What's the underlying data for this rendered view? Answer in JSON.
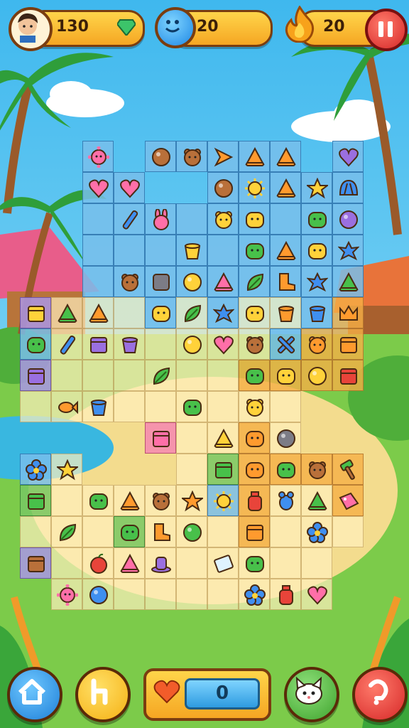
{
  "hud": {
    "score": "130",
    "gems": "20",
    "streak": "20"
  },
  "lives": {
    "value": "0"
  },
  "colors": {
    "accent": "#f5a623",
    "frame": "#7a3d10",
    "pause": "#d62828",
    "sky": "#6fd0f5",
    "grass": "#7ccb4a"
  },
  "board": {
    "rows": 15,
    "cols": 11
  },
  "tiles": [
    {
      "r": 0,
      "c": 2,
      "kind": "pink-virus",
      "t": "b"
    },
    {
      "r": 0,
      "c": 4,
      "kind": "brown-nut",
      "t": "b"
    },
    {
      "r": 0,
      "c": 5,
      "kind": "brown-bear",
      "t": "b"
    },
    {
      "r": 0,
      "c": 6,
      "kind": "orange-arrow",
      "t": "b"
    },
    {
      "r": 0,
      "c": 7,
      "kind": "orange-cone",
      "t": "b"
    },
    {
      "r": 0,
      "c": 8,
      "kind": "orange-cone",
      "t": "b"
    },
    {
      "r": 0,
      "c": 10,
      "kind": "purple-heart",
      "t": "b"
    },
    {
      "r": 1,
      "c": 2,
      "kind": "pink-heart",
      "t": "b"
    },
    {
      "r": 1,
      "c": 3,
      "kind": "pink-heart",
      "t": "b"
    },
    {
      "r": 1,
      "c": 6,
      "kind": "brown-nut",
      "t": "b"
    },
    {
      "r": 1,
      "c": 7,
      "kind": "yellow-sun",
      "t": "b"
    },
    {
      "r": 1,
      "c": 8,
      "kind": "orange-cone",
      "t": "b"
    },
    {
      "r": 1,
      "c": 9,
      "kind": "yellow-star",
      "t": "b"
    },
    {
      "r": 1,
      "c": 10,
      "kind": "blue-shell",
      "t": "b"
    },
    {
      "r": 2,
      "c": 3,
      "kind": "blue-stick",
      "t": "b"
    },
    {
      "r": 2,
      "c": 4,
      "kind": "pink-bunny",
      "t": "b"
    },
    {
      "r": 2,
      "c": 6,
      "kind": "yellow-bear",
      "t": "b"
    },
    {
      "r": 2,
      "c": 7,
      "kind": "yellow-blob",
      "t": "b"
    },
    {
      "r": 2,
      "c": 9,
      "kind": "green-blob",
      "t": "b"
    },
    {
      "r": 2,
      "c": 10,
      "kind": "purple-berry",
      "t": "b"
    },
    {
      "r": 3,
      "c": 5,
      "kind": "yellow-cup",
      "t": "b"
    },
    {
      "r": 3,
      "c": 7,
      "kind": "green-blob",
      "t": "b"
    },
    {
      "r": 3,
      "c": 8,
      "kind": "orange-cone",
      "t": "b"
    },
    {
      "r": 3,
      "c": 9,
      "kind": "yellow-blob",
      "t": "b"
    },
    {
      "r": 3,
      "c": 10,
      "kind": "blue-splat",
      "t": "b"
    },
    {
      "r": 4,
      "c": 3,
      "kind": "brown-bear",
      "t": "b"
    },
    {
      "r": 4,
      "c": 4,
      "kind": "gray-block",
      "t": "b"
    },
    {
      "r": 4,
      "c": 5,
      "kind": "yellow-ball",
      "t": "b"
    },
    {
      "r": 4,
      "c": 6,
      "kind": "pink-cone",
      "t": "b"
    },
    {
      "r": 4,
      "c": 7,
      "kind": "green-leaf",
      "t": "b"
    },
    {
      "r": 4,
      "c": 8,
      "kind": "orange-boot",
      "t": "b"
    },
    {
      "r": 4,
      "c": 9,
      "kind": "blue-splat",
      "t": "b"
    },
    {
      "r": 4,
      "c": 10,
      "kind": "green-cone",
      "t": "b"
    },
    {
      "r": 5,
      "c": 0,
      "kind": "yellow-box",
      "t": "p"
    },
    {
      "r": 5,
      "c": 1,
      "kind": "green-cone",
      "t": "w"
    },
    {
      "r": 5,
      "c": 2,
      "kind": "orange-cone",
      "t": "w"
    },
    {
      "r": 5,
      "c": 4,
      "kind": "yellow-blob",
      "t": "b"
    },
    {
      "r": 5,
      "c": 5,
      "kind": "green-leaf",
      "t": "w"
    },
    {
      "r": 5,
      "c": 6,
      "kind": "blue-splat",
      "t": "b"
    },
    {
      "r": 5,
      "c": 7,
      "kind": "yellow-blob",
      "t": "w"
    },
    {
      "r": 5,
      "c": 8,
      "kind": "orange-cup",
      "t": "w"
    },
    {
      "r": 5,
      "c": 9,
      "kind": "blue-cup",
      "t": "b"
    },
    {
      "r": 5,
      "c": 10,
      "kind": "orange-crown",
      "t": "o"
    },
    {
      "r": 6,
      "c": 0,
      "kind": "green-blob",
      "t": "b"
    },
    {
      "r": 6,
      "c": 1,
      "kind": "blue-stick",
      "t": "w"
    },
    {
      "r": 6,
      "c": 2,
      "kind": "purple-box",
      "t": "w"
    },
    {
      "r": 6,
      "c": 3,
      "kind": "purple-cup",
      "t": "w"
    },
    {
      "r": 6,
      "c": 5,
      "kind": "yellow-ball",
      "t": "w"
    },
    {
      "r": 6,
      "c": 6,
      "kind": "pink-heart",
      "t": "w"
    },
    {
      "r": 6,
      "c": 7,
      "kind": "brown-bear",
      "t": "w"
    },
    {
      "r": 6,
      "c": 8,
      "kind": "blue-cross",
      "t": "b"
    },
    {
      "r": 6,
      "c": 9,
      "kind": "orange-bear",
      "t": "o"
    },
    {
      "r": 6,
      "c": 10,
      "kind": "orange-box",
      "t": "o"
    },
    {
      "r": 7,
      "c": 0,
      "kind": "purple-box",
      "t": "p"
    },
    {
      "r": 7,
      "c": 4,
      "kind": "green-leaf",
      "t": "w"
    },
    {
      "r": 7,
      "c": 7,
      "kind": "green-blob",
      "t": "o"
    },
    {
      "r": 7,
      "c": 8,
      "kind": "yellow-blob",
      "t": "o"
    },
    {
      "r": 7,
      "c": 9,
      "kind": "yellow-ball",
      "t": "o"
    },
    {
      "r": 7,
      "c": 10,
      "kind": "red-box",
      "t": "o"
    },
    {
      "r": 8,
      "c": 1,
      "kind": "orange-fish",
      "t": "w"
    },
    {
      "r": 8,
      "c": 2,
      "kind": "blue-cup",
      "t": "w"
    },
    {
      "r": 8,
      "c": 5,
      "kind": "green-blob",
      "t": "w"
    },
    {
      "r": 8,
      "c": 7,
      "kind": "yellow-bear",
      "t": "w"
    },
    {
      "r": 9,
      "c": 4,
      "kind": "pink-box",
      "t": "pk"
    },
    {
      "r": 9,
      "c": 6,
      "kind": "yellow-cone",
      "t": "w"
    },
    {
      "r": 9,
      "c": 7,
      "kind": "orange-blob",
      "t": "o"
    },
    {
      "r": 9,
      "c": 8,
      "kind": "gray-ball",
      "t": "w"
    },
    {
      "r": 10,
      "c": 0,
      "kind": "blue-flower",
      "t": "b"
    },
    {
      "r": 10,
      "c": 1,
      "kind": "yellow-star",
      "t": "w"
    },
    {
      "r": 10,
      "c": 6,
      "kind": "green-box",
      "t": "g"
    },
    {
      "r": 10,
      "c": 7,
      "kind": "orange-blob",
      "t": "o"
    },
    {
      "r": 10,
      "c": 8,
      "kind": "green-blob",
      "t": "o"
    },
    {
      "r": 10,
      "c": 9,
      "kind": "brown-bear",
      "t": "o"
    },
    {
      "r": 10,
      "c": 10,
      "kind": "green-hammer",
      "t": "o"
    },
    {
      "r": 11,
      "c": 0,
      "kind": "green-box",
      "t": "g"
    },
    {
      "r": 11,
      "c": 2,
      "kind": "green-blob",
      "t": "w"
    },
    {
      "r": 11,
      "c": 3,
      "kind": "orange-cone",
      "t": "w"
    },
    {
      "r": 11,
      "c": 4,
      "kind": "brown-bear",
      "t": "w"
    },
    {
      "r": 11,
      "c": 5,
      "kind": "orange-star",
      "t": "w"
    },
    {
      "r": 11,
      "c": 6,
      "kind": "yellow-sun",
      "t": "b"
    },
    {
      "r": 11,
      "c": 7,
      "kind": "red-bottle",
      "t": "o"
    },
    {
      "r": 11,
      "c": 8,
      "kind": "blue-bug",
      "t": "w"
    },
    {
      "r": 11,
      "c": 9,
      "kind": "green-cone",
      "t": "w"
    },
    {
      "r": 11,
      "c": 10,
      "kind": "pink-tag",
      "t": "o"
    },
    {
      "r": 12,
      "c": 1,
      "kind": "green-leaf",
      "t": "w"
    },
    {
      "r": 12,
      "c": 3,
      "kind": "green-blob",
      "t": "g"
    },
    {
      "r": 12,
      "c": 4,
      "kind": "orange-boot",
      "t": "w"
    },
    {
      "r": 12,
      "c": 5,
      "kind": "green-ball",
      "t": "w"
    },
    {
      "r": 12,
      "c": 7,
      "kind": "orange-box",
      "t": "o"
    },
    {
      "r": 12,
      "c": 9,
      "kind": "blue-flower",
      "t": "w"
    },
    {
      "r": 13,
      "c": 0,
      "kind": "brown-box",
      "t": "p"
    },
    {
      "r": 13,
      "c": 2,
      "kind": "red-apple",
      "t": "w"
    },
    {
      "r": 13,
      "c": 3,
      "kind": "pink-cone",
      "t": "w"
    },
    {
      "r": 13,
      "c": 4,
      "kind": "purple-hat",
      "t": "w"
    },
    {
      "r": 13,
      "c": 6,
      "kind": "blue-card",
      "t": "w"
    },
    {
      "r": 13,
      "c": 7,
      "kind": "green-blob",
      "t": "w"
    },
    {
      "r": 14,
      "c": 1,
      "kind": "pink-virus",
      "t": "w"
    },
    {
      "r": 14,
      "c": 2,
      "kind": "blue-ball",
      "t": "w"
    },
    {
      "r": 14,
      "c": 7,
      "kind": "blue-flower",
      "t": "w"
    },
    {
      "r": 14,
      "c": 8,
      "kind": "red-bottle",
      "t": "w"
    },
    {
      "r": 14,
      "c": 9,
      "kind": "pink-heart",
      "t": "w"
    }
  ],
  "empty_cells": [
    {
      "r": 2,
      "c": 2,
      "t": "b"
    },
    {
      "r": 2,
      "c": 5,
      "t": "b"
    },
    {
      "r": 2,
      "c": 8,
      "t": "b"
    },
    {
      "r": 3,
      "c": 2,
      "t": "b"
    },
    {
      "r": 3,
      "c": 3,
      "t": "b"
    },
    {
      "r": 3,
      "c": 4,
      "t": "b"
    },
    {
      "r": 3,
      "c": 6,
      "t": "b"
    },
    {
      "r": 4,
      "c": 2,
      "t": "b"
    },
    {
      "r": 5,
      "c": 3,
      "t": "w"
    },
    {
      "r": 6,
      "c": 4,
      "t": "w"
    },
    {
      "r": 7,
      "c": 1,
      "t": "w"
    },
    {
      "r": 7,
      "c": 2,
      "t": "w"
    },
    {
      "r": 7,
      "c": 3,
      "t": "w"
    },
    {
      "r": 7,
      "c": 5,
      "t": "w"
    },
    {
      "r": 7,
      "c": 6,
      "t": "w"
    },
    {
      "r": 8,
      "c": 0,
      "t": "w"
    },
    {
      "r": 8,
      "c": 3,
      "t": "w"
    },
    {
      "r": 8,
      "c": 4,
      "t": "w"
    },
    {
      "r": 8,
      "c": 6,
      "t": "w"
    },
    {
      "r": 8,
      "c": 8,
      "t": "w"
    },
    {
      "r": 9,
      "c": 5,
      "t": "w"
    },
    {
      "r": 10,
      "c": 5,
      "t": "w"
    },
    {
      "r": 11,
      "c": 1,
      "t": "w"
    },
    {
      "r": 12,
      "c": 0,
      "t": "w"
    },
    {
      "r": 12,
      "c": 2,
      "t": "w"
    },
    {
      "r": 12,
      "c": 6,
      "t": "w"
    },
    {
      "r": 12,
      "c": 8,
      "t": "w"
    },
    {
      "r": 12,
      "c": 10,
      "t": "w"
    },
    {
      "r": 13,
      "c": 1,
      "t": "w"
    },
    {
      "r": 13,
      "c": 5,
      "t": "w"
    },
    {
      "r": 13,
      "c": 8,
      "t": "w"
    },
    {
      "r": 13,
      "c": 9,
      "t": "w"
    },
    {
      "r": 14,
      "c": 3,
      "t": "w"
    },
    {
      "r": 14,
      "c": 4,
      "t": "w"
    },
    {
      "r": 14,
      "c": 5,
      "t": "w"
    },
    {
      "r": 14,
      "c": 6,
      "t": "w"
    }
  ]
}
